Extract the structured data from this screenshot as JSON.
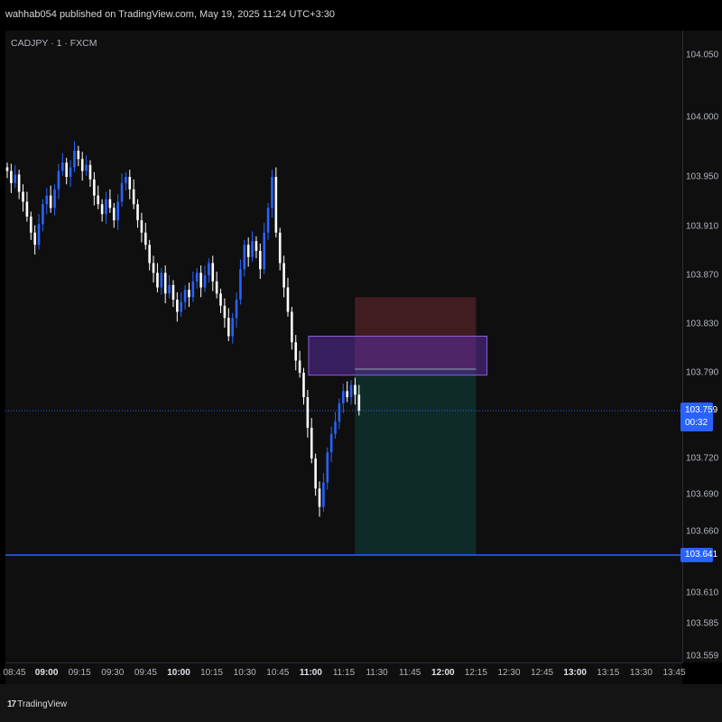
{
  "header": {
    "published_text": "wahhab054 published on TradingView.com, May 19, 2025 11:24 UTC+3:30"
  },
  "chart": {
    "symbol_line": "CADJPY · 1 · FXCM",
    "current_price": "103.759",
    "countdown": "00:32",
    "horizontal_line_label": "103.641"
  },
  "footer": {
    "logo_text": "TradingView",
    "logo_mark": "17"
  },
  "colors": {
    "accent": "#2962ff",
    "bull": "#2962ff",
    "bear": "#ffffff",
    "stop_zone": "#4a1f24",
    "target_zone": "#0f2f2b",
    "box_zone": "#5a2da0"
  },
  "chart_data": {
    "type": "candlestick",
    "y_ticks": [
      "104.050",
      "104.000",
      "103.950",
      "103.910",
      "103.870",
      "103.830",
      "103.790",
      "103.759",
      "103.720",
      "103.690",
      "103.660",
      "103.641",
      "103.610",
      "103.585",
      "103.559"
    ],
    "x_ticks": [
      {
        "label": "08:45",
        "bold": false
      },
      {
        "label": "09:00",
        "bold": true
      },
      {
        "label": "09:15",
        "bold": false
      },
      {
        "label": "09:30",
        "bold": false
      },
      {
        "label": "09:45",
        "bold": false
      },
      {
        "label": "10:00",
        "bold": true
      },
      {
        "label": "10:15",
        "bold": false
      },
      {
        "label": "10:30",
        "bold": false
      },
      {
        "label": "10:45",
        "bold": false
      },
      {
        "label": "11:00",
        "bold": true
      },
      {
        "label": "11:15",
        "bold": false
      },
      {
        "label": "11:30",
        "bold": false
      },
      {
        "label": "11:45",
        "bold": false
      },
      {
        "label": "12:00",
        "bold": true
      },
      {
        "label": "12:15",
        "bold": false
      },
      {
        "label": "12:30",
        "bold": false
      },
      {
        "label": "12:45",
        "bold": false
      },
      {
        "label": "13:00",
        "bold": true
      },
      {
        "label": "13:15",
        "bold": false
      },
      {
        "label": "13:30",
        "bold": false
      },
      {
        "label": "13:45",
        "bold": false
      }
    ],
    "horizontal_line": 103.641,
    "current_price": 103.759,
    "position_tool": {
      "entry": 103.793,
      "stop": 103.852,
      "target": 103.641,
      "start": "11:20",
      "end": "12:15"
    },
    "zone_box": {
      "top": 103.82,
      "bottom": 103.788,
      "start": "10:59",
      "end": "12:20"
    },
    "closes": [
      103.955,
      103.945,
      103.952,
      103.938,
      103.93,
      103.918,
      103.905,
      103.895,
      103.912,
      103.928,
      103.935,
      103.925,
      103.94,
      103.955,
      103.962,
      103.95,
      103.958,
      103.972,
      103.965,
      103.955,
      103.96,
      103.948,
      103.935,
      103.928,
      103.92,
      103.932,
      103.925,
      103.915,
      103.93,
      103.945,
      103.95,
      103.94,
      103.928,
      103.915,
      103.905,
      103.895,
      103.88,
      103.872,
      103.86,
      103.872,
      103.855,
      103.862,
      103.85,
      103.84,
      103.848,
      103.858,
      103.852,
      103.865,
      103.872,
      103.86,
      103.87,
      103.88,
      103.865,
      103.855,
      103.845,
      103.835,
      103.82,
      103.835,
      103.85,
      103.875,
      103.895,
      103.885,
      103.898,
      103.89,
      103.875,
      103.905,
      103.925,
      103.95,
      103.905,
      103.88,
      103.86,
      103.84,
      103.815,
      103.8,
      103.79,
      103.77,
      103.745,
      103.72,
      103.695,
      103.68,
      103.7,
      103.725,
      103.74,
      103.75,
      103.765,
      103.775,
      103.77,
      103.78,
      103.772,
      103.759
    ]
  }
}
